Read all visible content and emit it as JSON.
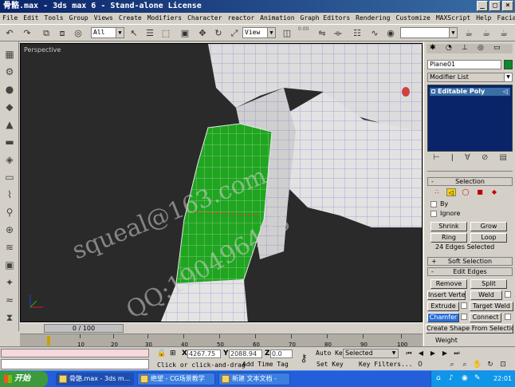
{
  "window": {
    "title": "骨骼.max - 3ds max 6 - Stand-alone License",
    "buttons": [
      "_",
      "□",
      "×"
    ]
  },
  "menu": [
    "File",
    "Edit",
    "Tools",
    "Group",
    "Views",
    "Create",
    "Modifiers",
    "Character",
    "reactor",
    "Animation",
    "Graph Editors",
    "Rendering",
    "Customize",
    "MAXScript",
    "Help",
    "Facial Studio"
  ],
  "toolbar": {
    "selection_filter": "All",
    "ref_coord": "View",
    "spinner_value": "0.00"
  },
  "viewport": {
    "label": "Perspective",
    "frame_counter": "0 / 100",
    "watermark_lines": [
      "squeal@163.com",
      "QQ:190496493"
    ]
  },
  "timeline": {
    "ticks": [
      "10",
      "20",
      "30",
      "40",
      "50",
      "60",
      "70",
      "80",
      "90",
      "100"
    ]
  },
  "command_panel": {
    "object_name": "Plane01",
    "modifier_list": "Modifier List",
    "stack_item": "Editable Poly",
    "selection_rollout": "Selection",
    "by_label": "By",
    "ignore_label": "Ignore",
    "shrink": "Shrink",
    "grow": "Grow",
    "ring": "Ring",
    "loop": "Loop",
    "edges_selected": "24 Edges Selected",
    "soft_selection": "Soft Selection",
    "edit_edges": "Edit Edges",
    "remove": "Remove",
    "split": "Split",
    "insert_vertex": "Insert Vertex",
    "weld": "Weld",
    "extrude": "Extrude",
    "target_weld": "Target Weld",
    "chamfer": "Chamfer",
    "connect": "Connect",
    "create_shape": "Create Shape From Selection",
    "weight": "Weight"
  },
  "status": {
    "x_label": "X",
    "x_value": "4267.75",
    "y_label": "Y",
    "y_value": "2088.94",
    "z_label": "Z",
    "z_value": "0.0",
    "prompt": "Click or click-and-drag",
    "add_time_tag": "Add Time Tag",
    "auto_key": "Auto Key",
    "selected": "Selected",
    "set_key": "Set Key",
    "key_filters": "Key Filters..."
  },
  "taskbar": {
    "start": "开始",
    "tasks": [
      "骨骼.max - 3ds m...",
      "绝望 - CG场景教学",
      "新建 文本文档 -"
    ],
    "clock": "22:01"
  },
  "colors": {
    "title_bar": "#0a246a",
    "viewport_bg": "#2a2a2a",
    "selected_mesh": "#22a022",
    "taskbar": "#245edb"
  }
}
